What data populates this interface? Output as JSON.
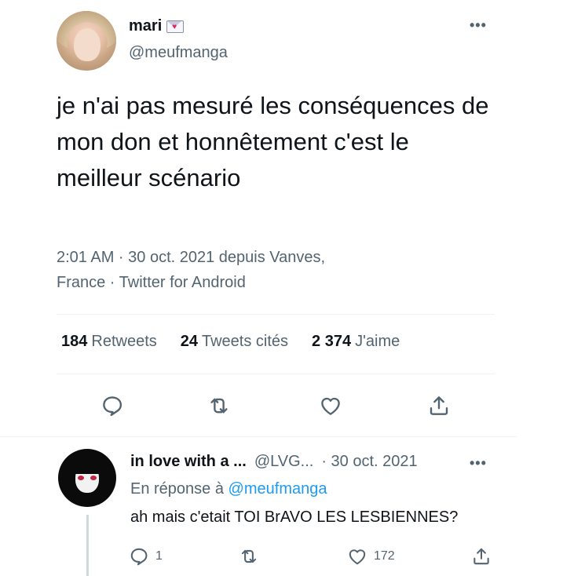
{
  "tweet": {
    "author_name": "mari",
    "author_handle": "@meufmanga",
    "text": "je n'ai pas mesuré les conséquences de mon don et honnêtement c'est le meilleur scénario",
    "meta_line1": "2:01 AM · 30 oct. 2021 depuis Vanves,",
    "meta_line2": "France · Twitter for Android",
    "more": "•••",
    "stats": {
      "retweets_count": "184",
      "retweets_label": "Retweets",
      "quotes_count": "24",
      "quotes_label": "Tweets cités",
      "likes_count": "2 374",
      "likes_label": "J'aime"
    }
  },
  "reply": {
    "name": "in love with a ...",
    "handle": "@LVG...",
    "date": "· 30 oct. 2021",
    "more": "•••",
    "replying_prefix": "En réponse à",
    "replying_mention": "@meufmanga",
    "text": "ah mais c'etait TOI BrAVO LES LESBIENNES?",
    "reply_count": "1",
    "like_count": "172"
  },
  "colors": {
    "text_primary": "#0f1419",
    "text_secondary": "#536471",
    "accent": "#1d9bf0",
    "divider": "#eff3f4"
  },
  "icons": [
    "envelope-heart-icon",
    "more-icon",
    "reply-icon",
    "retweet-icon",
    "like-icon",
    "share-icon"
  ]
}
